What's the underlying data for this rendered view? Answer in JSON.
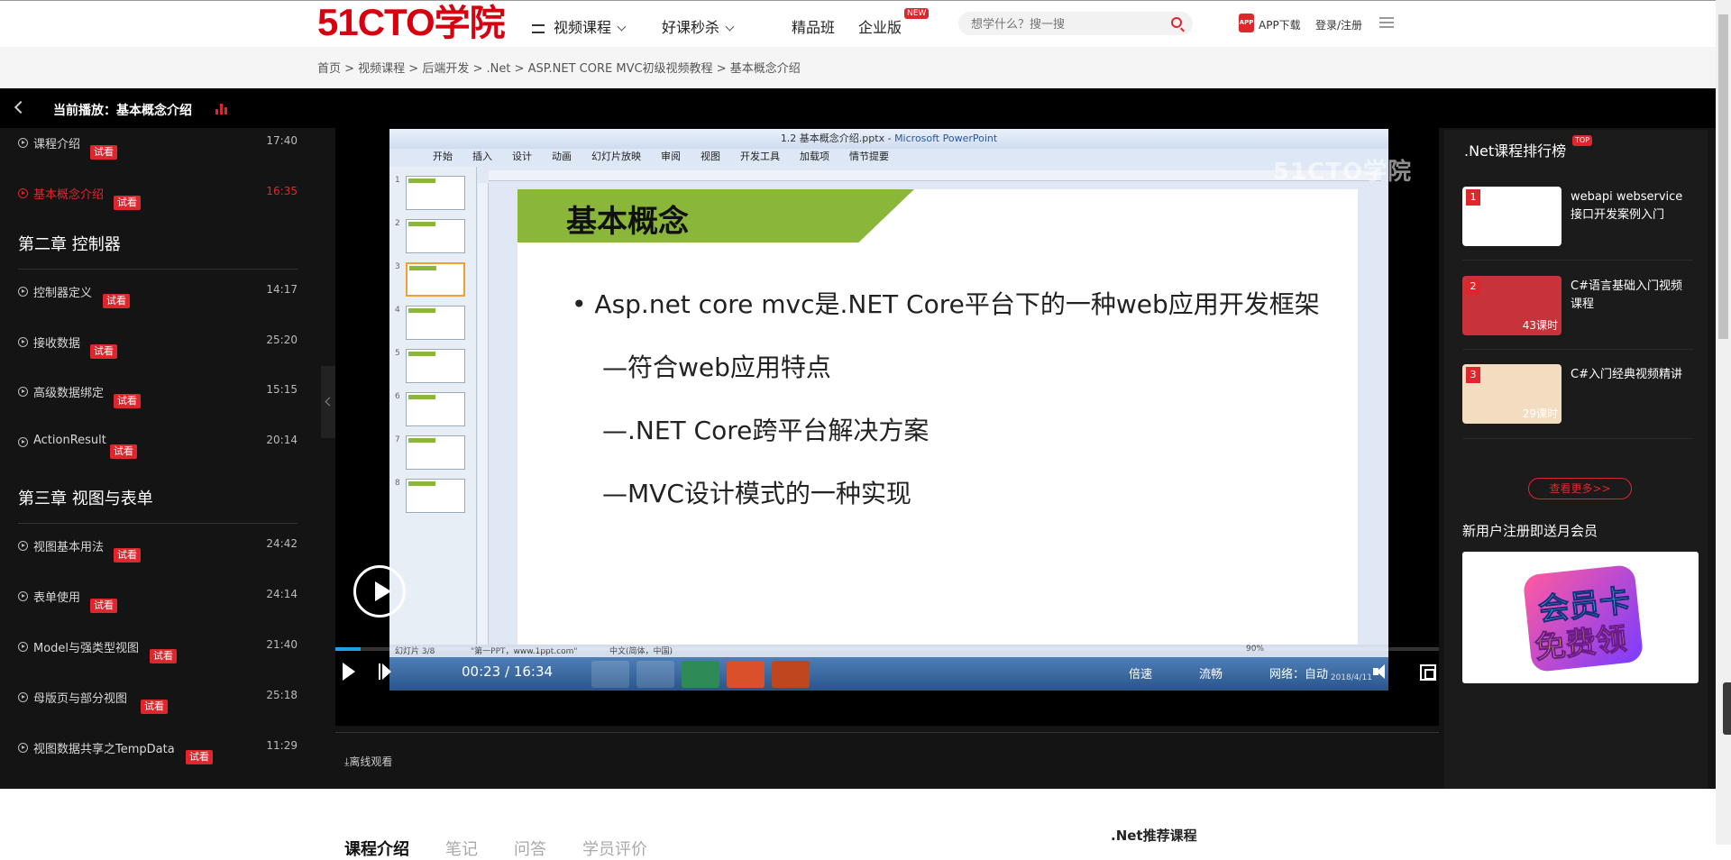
{
  "site": {
    "logo_latin": "51CTO",
    "logo_cn": "学院",
    "nav": [
      {
        "label": "视频课程"
      },
      {
        "label": "好课秒杀"
      },
      {
        "label": "精品班"
      },
      {
        "label": "企业版"
      }
    ],
    "new_badge": "NEW",
    "search_placeholder": "想学什么？搜一搜",
    "app_icon_text": "APP",
    "app_download": "APP下载",
    "login": "登录/注册"
  },
  "breadcrumb": "首页 > 视频课程 > 后端开发 > .Net > ASP.NET CORE MVC初级视频教程 > 基本概念介绍",
  "now_playing": "当前播放：基本概念介绍",
  "playlist": {
    "trial_label": "试看",
    "items": [
      {
        "title": "课程介绍",
        "duration": "17:40"
      },
      {
        "title": "基本概念介绍",
        "duration": "16:35"
      },
      {
        "title": "控制器定义",
        "duration": "14:17"
      },
      {
        "title": "接收数据",
        "duration": "25:20"
      },
      {
        "title": "高级数据绑定",
        "duration": "15:15"
      },
      {
        "title": "ActionResult",
        "duration": "20:14"
      },
      {
        "title": "视图基本用法",
        "duration": "24:42"
      },
      {
        "title": "表单使用",
        "duration": "24:14"
      },
      {
        "title": "Model与强类型视图",
        "duration": "21:40"
      },
      {
        "title": "母版页与部分视图",
        "duration": "25:18"
      },
      {
        "title": "视图数据共享之TempData",
        "duration": "11:29"
      }
    ],
    "chapters": [
      "第二章 控制器",
      "第三章 视图与表单"
    ]
  },
  "slide": {
    "window_title": "1.2 基本概念介绍.pptx - ",
    "window_app": "Microsoft PowerPoint",
    "ribbon_tabs": [
      "开始",
      "插入",
      "设计",
      "动画",
      "幻灯片放映",
      "审阅",
      "视图",
      "开发工具",
      "加载项",
      "情节提要"
    ],
    "heading": "基本概念",
    "lines": [
      "• Asp.net core mvc是.NET Core平台下的一种web应用开发框架",
      "—符合web应用特点",
      "—.NET Core跨平台解决方案",
      "—MVC设计模式的一种实现"
    ],
    "status_left": "幻灯片 3/8",
    "status_theme": "\"第一PPT，www.1ppt.com\"",
    "status_lang": "中文(简体，中国)",
    "status_zoom": "90%",
    "clock_date": "2018/4/11",
    "watermark": "51CTO学院"
  },
  "player": {
    "time": "00:23 / 16:34",
    "progress_percent": 2.3,
    "speed": "倍速",
    "quality": "流畅",
    "network": "网络：自动",
    "offline": "离线观看"
  },
  "ranking": {
    "title": ".Net课程排行榜",
    "top_badge": "TOP",
    "items": [
      {
        "rank": "1",
        "name": "webapi webservice 接口开发案例入门",
        "hours": ""
      },
      {
        "rank": "2",
        "name": "C#语言基础入门视频课程",
        "hours": "43课时"
      },
      {
        "rank": "3",
        "name": "C#入门经典视频精讲",
        "hours": "29课时"
      }
    ],
    "more": "查看更多>>",
    "promo_title": "新用户注册即送月会员",
    "promo_line1": "会员卡",
    "promo_line2": "免费领"
  },
  "below": {
    "tabs": [
      "课程介绍",
      "笔记",
      "问答",
      "学员评价"
    ],
    "recommend_title": ".Net推荐课程"
  },
  "colors": {
    "brand_red": "#e0262d",
    "progress_blue": "#1aa3e6",
    "slide_green": "#8ab73a"
  }
}
